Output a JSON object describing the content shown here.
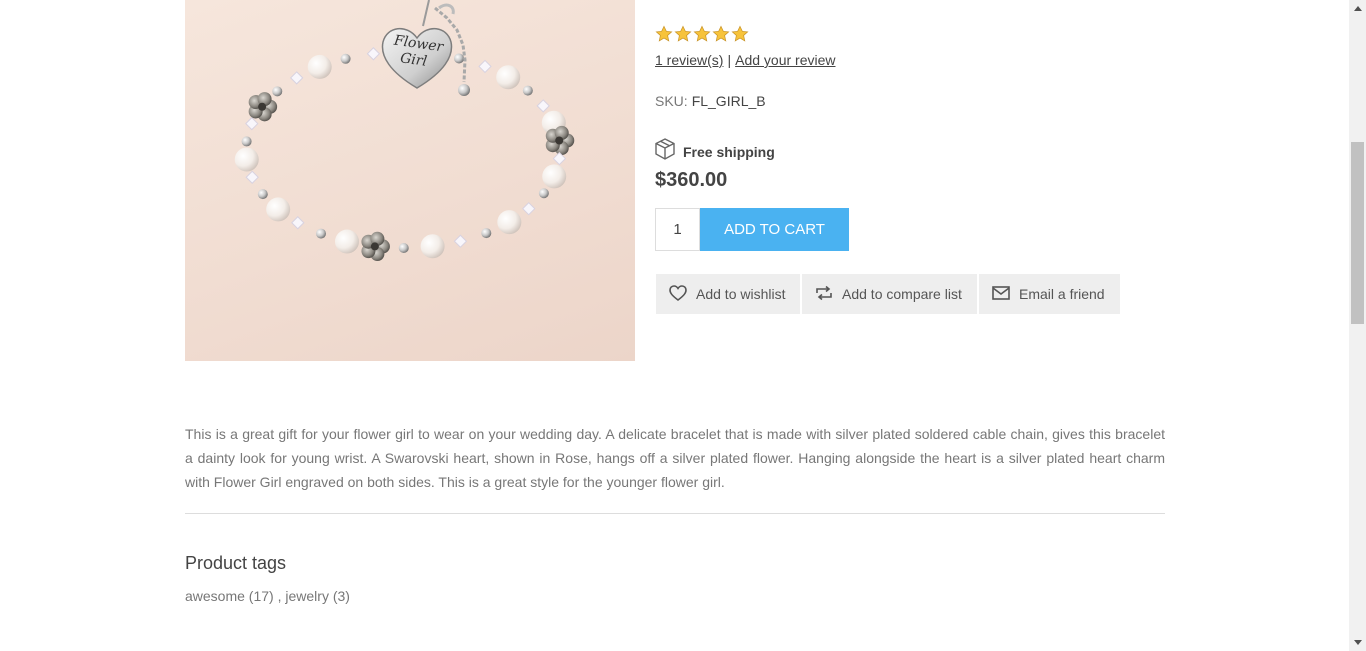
{
  "product": {
    "image_alt": "Flower Girl bracelet",
    "charm_text_line1": "Flower",
    "charm_text_line2": "Girl",
    "rating": {
      "stars": 5,
      "max": 5
    },
    "reviews_link": "1 review(s)",
    "reviews_separator": "|",
    "add_review_link": "Add your review",
    "sku_label": "SKU:",
    "sku_value": "FL_GIRL_B",
    "shipping_label": "Free shipping",
    "price": "$360.00",
    "quantity": "1",
    "add_to_cart_label": "ADD TO CART",
    "actions": {
      "wishlist": "Add to wishlist",
      "compare": "Add to compare list",
      "email": "Email a friend"
    },
    "description": "This is a great gift for your flower girl to wear on your wedding day. A delicate bracelet that is made with silver plated soldered cable chain, gives this bracelet a dainty look for young wrist. A Swarovski heart, shown in Rose, hangs off a silver plated flower. Hanging alongside the heart is a silver plated heart charm with Flower Girl engraved on both sides. This is a great style for the younger flower girl."
  },
  "tags": {
    "title": "Product tags",
    "items": [
      {
        "label": "awesome (17)"
      },
      {
        "label": "jewelry (3)"
      }
    ],
    "separator": " , "
  },
  "colors": {
    "accent": "#4ab2f1",
    "star": "#f7c33b",
    "action_bg": "#eeeeee"
  },
  "icons": {
    "shipping": "box-icon",
    "wishlist": "heart-icon",
    "compare": "compare-arrows-icon",
    "email": "envelope-icon"
  }
}
